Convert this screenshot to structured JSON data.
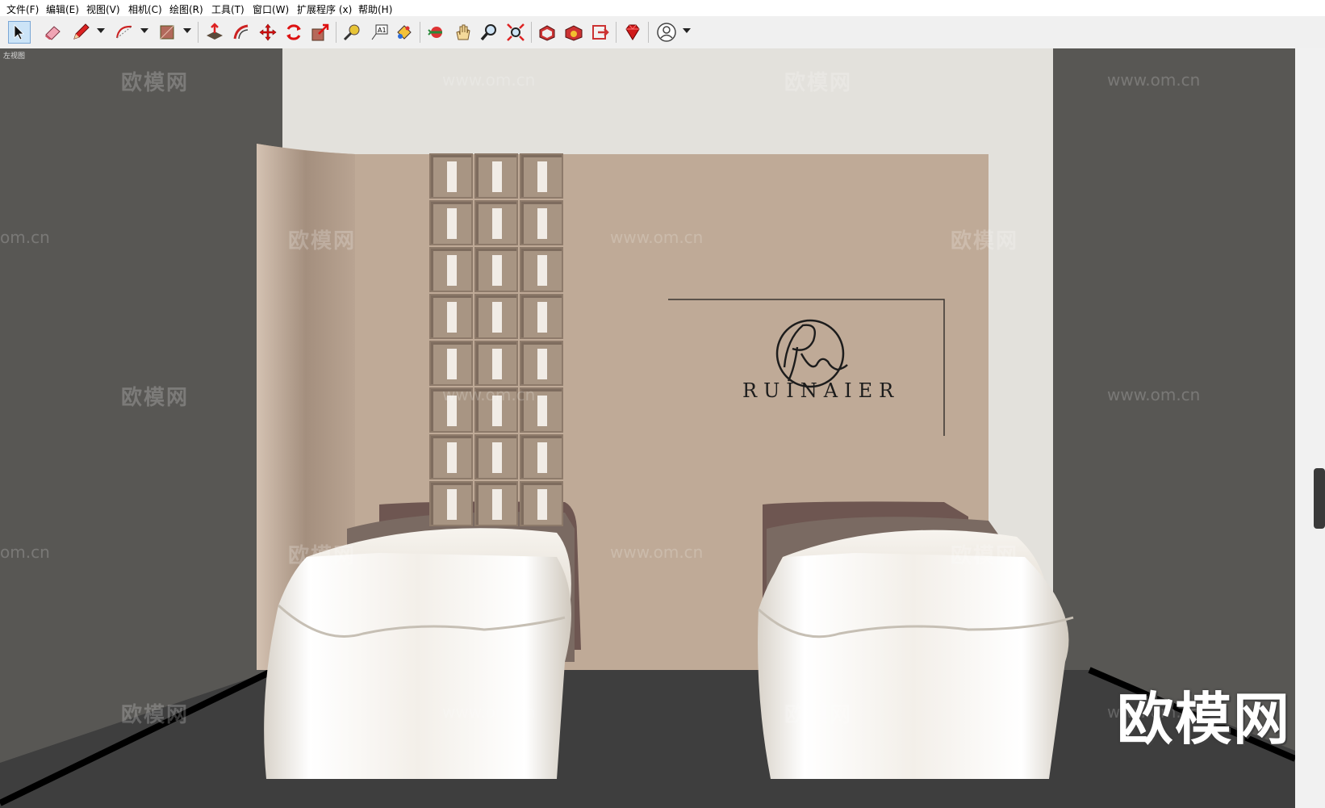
{
  "menu": [
    "文件(F)",
    "编辑(E)",
    "视图(V)",
    "相机(C)",
    "绘图(R)",
    "工具(T)",
    "窗口(W)",
    "扩展程序 (x)",
    "帮助(H)"
  ],
  "toolbar": {
    "icons": [
      "select-icon",
      "eraser-icon",
      "pencil-line-icon",
      "arc-icon",
      "shape-rectangle-icon",
      "push-pull-icon",
      "offset-icon",
      "move-icon",
      "rotate-icon",
      "scale-icon",
      "tape-measure-icon",
      "text-label-icon",
      "paint-bucket-icon",
      "orbit-icon",
      "pan-hand-icon",
      "zoom-icon",
      "zoom-extents-icon",
      "3d-warehouse-icon",
      "extension-warehouse-icon",
      "layout-send-icon",
      "ruby-console-icon",
      "account-icon"
    ]
  },
  "viewport": {
    "scene_label": "左视图",
    "watermark_cn": "欧模网",
    "watermark_url": "www.om.cn",
    "watermark_url_partial": "om.cn",
    "big_watermark": "欧模网",
    "logo_monogram": "Rn",
    "logo_brand": "RUINAIER"
  },
  "colors": {
    "accent_selected": "#cce4f7",
    "scene_bg": "#585754",
    "back_wall": "#e3e1dc",
    "feature_wall": "#bfaa97",
    "floor": "#3f3f3f"
  }
}
